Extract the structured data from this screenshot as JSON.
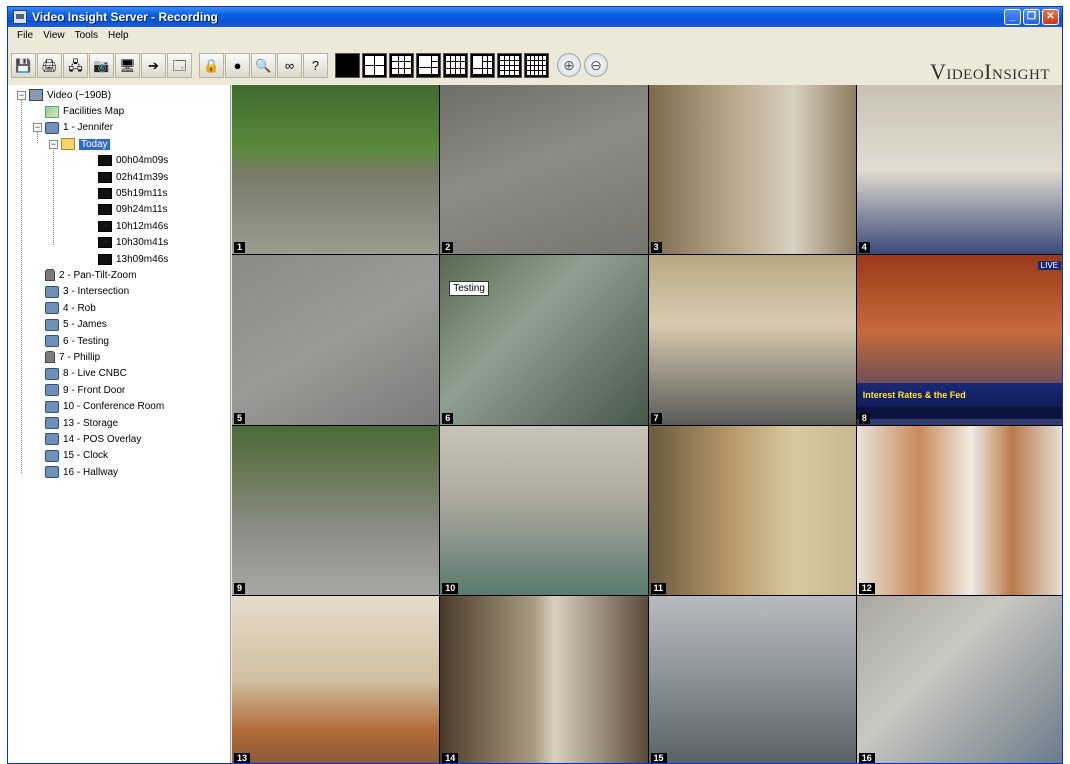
{
  "window": {
    "title": "Video Insight Server - Recording"
  },
  "menu": [
    "File",
    "View",
    "Tools",
    "Help"
  ],
  "toolbar": {
    "buttons": [
      {
        "name": "save",
        "icon": "💾"
      },
      {
        "name": "print",
        "icon": "🖨"
      },
      {
        "name": "network",
        "icon": "🖧"
      },
      {
        "name": "camera-settings",
        "icon": "📷"
      },
      {
        "name": "monitor",
        "icon": "🖥"
      },
      {
        "name": "forward",
        "icon": "➔"
      },
      {
        "name": "window",
        "icon": "🗔"
      },
      {
        "name": "lock",
        "icon": "🔒"
      },
      {
        "name": "record",
        "icon": "●"
      },
      {
        "name": "search",
        "icon": "🔍"
      },
      {
        "name": "link",
        "icon": "∞"
      },
      {
        "name": "help",
        "icon": "?"
      }
    ],
    "brand": "VideoInsight"
  },
  "tree": {
    "root": "Video (~190B)",
    "facilities": "Facilities Map",
    "camera1": "1 - Jennifer",
    "today": "Today",
    "clips": [
      "00h04m09s",
      "02h41m39s",
      "05h19m11s",
      "09h24m11s",
      "10h12m46s",
      "10h30m41s",
      "13h09m46s"
    ],
    "cameras": [
      {
        "label": "2 - Pan-Tilt-Zoom",
        "type": "ptz"
      },
      {
        "label": "3 - Intersection",
        "type": "cam"
      },
      {
        "label": "4 - Rob",
        "type": "cam"
      },
      {
        "label": "5 - James",
        "type": "cam"
      },
      {
        "label": "6 - Testing",
        "type": "cam"
      },
      {
        "label": "7 - Phillip",
        "type": "ptz"
      },
      {
        "label": "8 - Live CNBC",
        "type": "cam"
      },
      {
        "label": "9 - Front Door",
        "type": "cam"
      },
      {
        "label": "10 - Conference Room",
        "type": "cam"
      },
      {
        "label": "13 - Storage",
        "type": "cam"
      },
      {
        "label": "14 - POS Overlay",
        "type": "cam"
      },
      {
        "label": "15 - Clock",
        "type": "cam"
      },
      {
        "label": "16 - Hallway",
        "type": "cam"
      }
    ]
  },
  "tiles": {
    "numbers": [
      "1",
      "2",
      "3",
      "4",
      "5",
      "6",
      "7",
      "8",
      "9",
      "10",
      "11",
      "12",
      "13",
      "14",
      "15",
      "16"
    ],
    "overlay6": "Testing",
    "ticker8": "Interest Rates & the Fed",
    "live8": "LIVE"
  }
}
